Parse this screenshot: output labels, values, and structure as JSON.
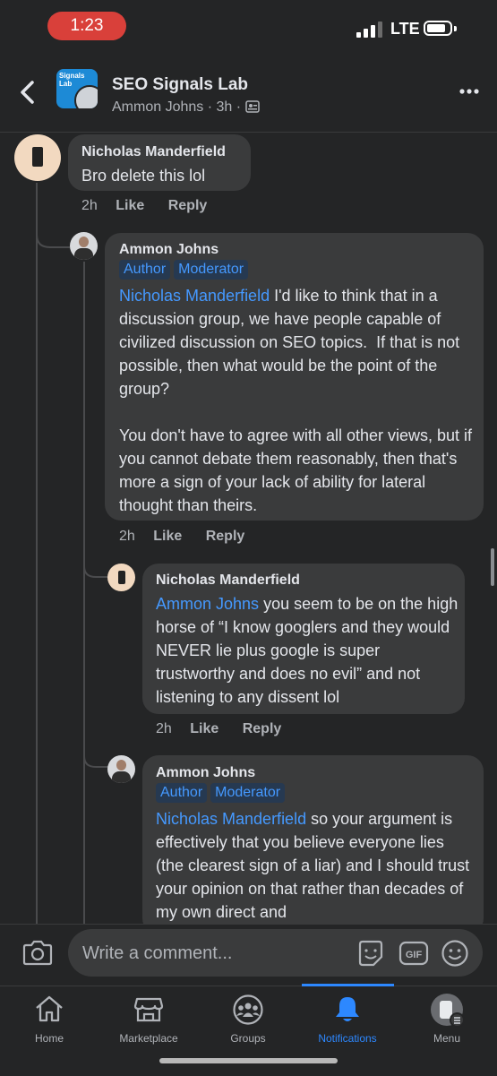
{
  "status_bar": {
    "time": "1:23",
    "network": "LTE"
  },
  "header": {
    "group_name": "SEO Signals Lab",
    "author": "Ammon Johns",
    "age": "3h",
    "avatar_text": "Signals Lab"
  },
  "comments": [
    {
      "author": "Nicholas Manderfield",
      "text": "Bro delete this lol",
      "time": "2h",
      "like": "Like",
      "reply": "Reply"
    },
    {
      "author": "Ammon Johns",
      "badges": [
        "Author",
        "Moderator"
      ],
      "mention": "Nicholas Manderfield",
      "text": " I'd like to think that in a discussion group, we have people capable of civilized discussion on SEO topics.  If that is not possible, then what would be the point of the group?\n\nYou don't have to agree with all other views, but if you cannot debate them reasonably, then that's more a sign of your lack of ability for lateral thought than theirs.",
      "time": "2h",
      "like": "Like",
      "reply": "Reply"
    },
    {
      "author": "Nicholas Manderfield",
      "mention": "Ammon Johns",
      "text": " you seem to be on the high horse of “I know googlers and they would NEVER lie plus google is super trustworthy and does no evil” and not listening to any dissent lol",
      "time": "2h",
      "like": "Like",
      "reply": "Reply"
    },
    {
      "author": "Ammon Johns",
      "badges": [
        "Author",
        "Moderator"
      ],
      "mention": "Nicholas Manderfield",
      "text": " so your argument is effectively that you believe everyone lies (the clearest sign of a liar) and I should trust your opinion on that rather than decades of my own direct and"
    }
  ],
  "composer": {
    "placeholder": "Write a comment..."
  },
  "tabs": [
    {
      "label": "Home",
      "icon": "home-icon"
    },
    {
      "label": "Marketplace",
      "icon": "marketplace-icon"
    },
    {
      "label": "Groups",
      "icon": "groups-icon"
    },
    {
      "label": "Notifications",
      "icon": "bell-icon",
      "active": true
    },
    {
      "label": "Menu",
      "icon": "profile-avatar"
    }
  ],
  "colors": {
    "accent": "#2d88ff",
    "mention": "#4599ff",
    "background": "#242526",
    "bubble": "#3a3b3c"
  }
}
